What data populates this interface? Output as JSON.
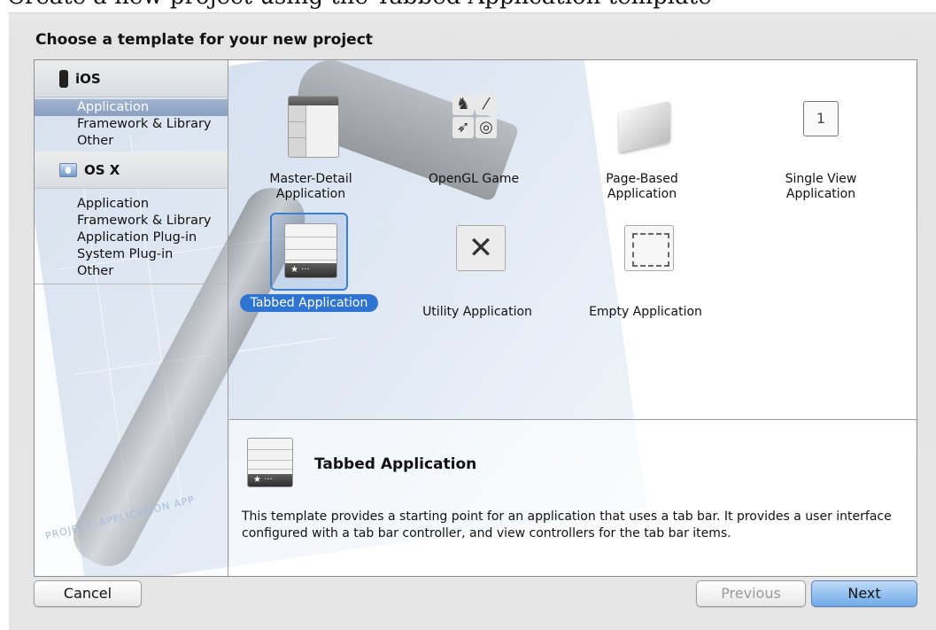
{
  "caption": "Create a new project using the Tabbed Application template",
  "dialog": {
    "title": "Choose a template for your new project"
  },
  "sidebar": {
    "groups": [
      {
        "label": "iOS",
        "icon": "iphone-icon",
        "items": [
          "Application",
          "Framework & Library",
          "Other"
        ],
        "selected": "Application"
      },
      {
        "label": "OS X",
        "icon": "mac-finder-icon",
        "items": [
          "Application",
          "Framework & Library",
          "Application Plug-in",
          "System Plug-in",
          "Other"
        ]
      }
    ]
  },
  "templates": [
    {
      "label": "Master-Detail Application",
      "icon": "master-detail-icon"
    },
    {
      "label": "OpenGL Game",
      "icon": "opengl-game-icon"
    },
    {
      "label": "Page-Based Application",
      "icon": "page-based-icon"
    },
    {
      "label": "Single View Application",
      "icon": "single-view-icon",
      "glyph": "1"
    },
    {
      "label": "Tabbed Application",
      "icon": "tabbed-application-icon",
      "selected": true
    },
    {
      "label": "Utility Application",
      "icon": "utility-application-icon"
    },
    {
      "label": "Empty Application",
      "icon": "empty-application-icon"
    }
  ],
  "description": {
    "title": "Tabbed Application",
    "text": "This template provides a starting point for an application that uses a tab bar. It provides a user interface configured with a tab bar controller, and view controllers for the tab bar items."
  },
  "backdrop": {
    "stamp_text": "PROJECT: APPLICATION APP"
  },
  "buttons": {
    "cancel": "Cancel",
    "previous": "Previous",
    "next": "Next"
  },
  "colors": {
    "selection": "#2f74d0",
    "sidebar_selected": "#8a9fc2",
    "next_button": "#6faae8"
  }
}
